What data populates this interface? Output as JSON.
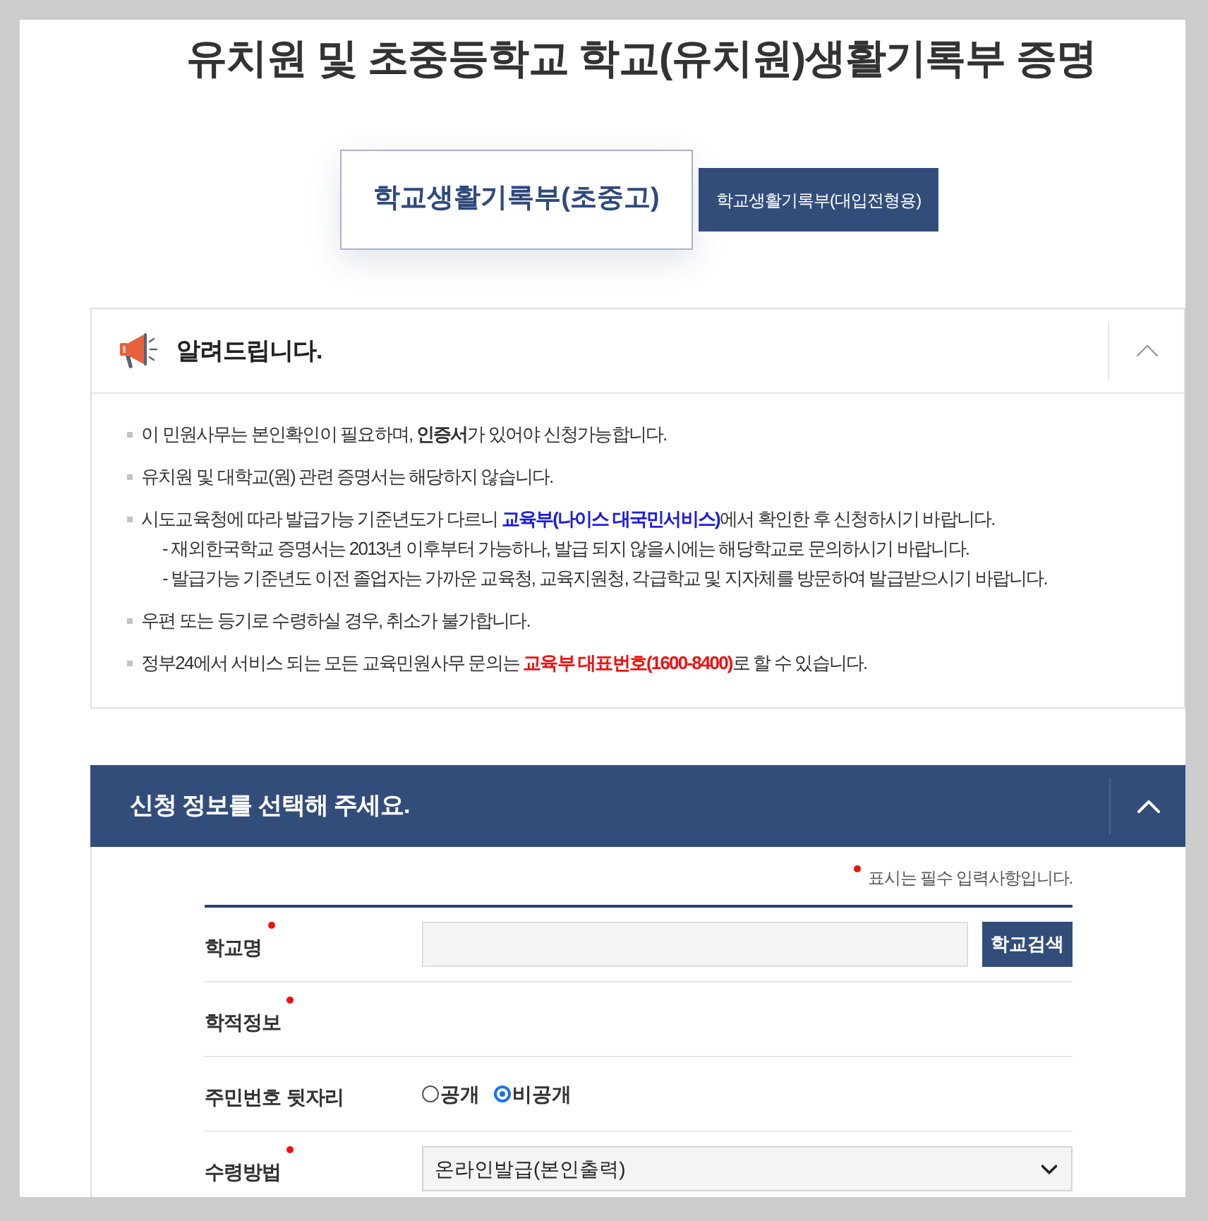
{
  "page_title": "유치원 및 초중등학교 학교(유치원)생활기록부 증명",
  "tabs": [
    {
      "label": "학교생활기록부(초중고)",
      "selected": true
    },
    {
      "label": "학교생활기록부(대입전형용)",
      "selected": false
    }
  ],
  "notice": {
    "title": "알려드립니다.",
    "expanded": true,
    "items": [
      {
        "parts": [
          {
            "kind": "text",
            "text": "이 민원사무는 본인확인이 필요하며, **인증서**가 있어야 신청가능합니다."
          }
        ]
      },
      {
        "parts": [
          {
            "kind": "text",
            "text": "유치원 및 대학교(원) 관련 증명서는 해당하지 않습니다."
          }
        ]
      },
      {
        "parts": [
          {
            "kind": "text",
            "text": "시도교육청에 따라 발급가능 기준년도가 다르니 "
          },
          {
            "kind": "link",
            "text": "교육부(나이스 대국민서비스)"
          },
          {
            "kind": "text",
            "text": "에서 확인한 후 신청하시기 바랍니다."
          }
        ],
        "children": [
          {
            "parts": [
              {
                "kind": "text",
                "text": "- 재외한국학교 증명서는 2013년 이후부터 가능하나, 발급 되지 않을시에는 해당학교로 문의하시기 바랍니다."
              }
            ]
          },
          {
            "parts": [
              {
                "kind": "text",
                "text": "- 발급가능 기준년도 이전 졸업자는 가까운 교육청, 교육지원청, 각급학교 및 지자체를 방문하여 발급받으시기 바랍니다."
              }
            ]
          }
        ]
      },
      {
        "parts": [
          {
            "kind": "text",
            "text": "우편 또는 등기로 수령하실 경우, 취소가 불가합니다."
          }
        ]
      },
      {
        "parts": [
          {
            "kind": "text",
            "text": "정부24에서 서비스 되는 모든 교육민원사무 문의는 "
          },
          {
            "kind": "emphasis",
            "text": "교육부 대표번호(1600-8400)"
          },
          {
            "kind": "text",
            "text": "로 할 수 있습니다."
          }
        ]
      }
    ]
  },
  "form": {
    "title": "신청 정보를 선택해 주세요.",
    "expanded": true,
    "required_note": "표시는 필수 입력사항입니다.",
    "rows": [
      {
        "label": "학교명",
        "required": true,
        "kind": "search",
        "button": "학교검색"
      },
      {
        "label": "학적정보",
        "required": true,
        "kind": "empty"
      },
      {
        "label": "주민번호 뒷자리",
        "required": false,
        "kind": "radio",
        "options": [
          {
            "label": "공개",
            "selected": false
          },
          {
            "label": "비공개",
            "selected": true
          }
        ]
      },
      {
        "label": "수령방법",
        "required": true,
        "kind": "select",
        "value": "온라인발급(본인출력)"
      }
    ]
  }
}
